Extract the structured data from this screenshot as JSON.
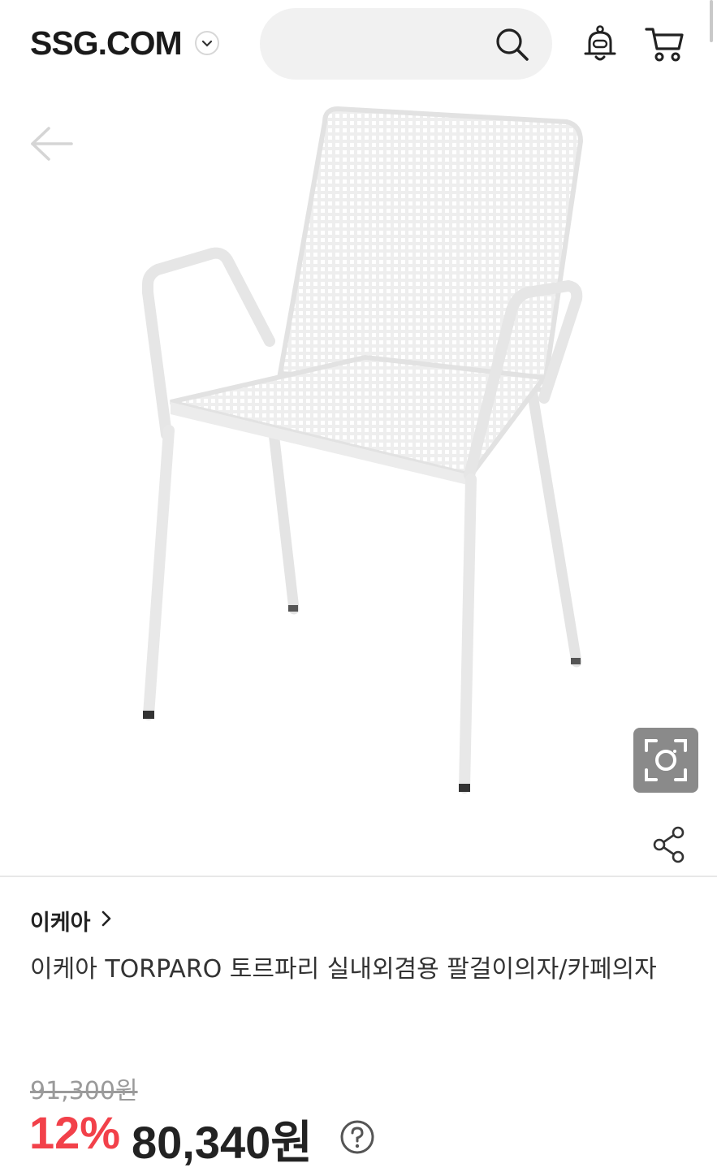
{
  "header": {
    "logo": "SSG.COM",
    "search_placeholder": ""
  },
  "icons": {
    "logo_dropdown": "chevron-down-icon",
    "search": "search-icon",
    "notification": "bell-icon",
    "cart": "cart-icon",
    "back": "back-arrow-icon",
    "lens": "lens-search-icon",
    "share": "share-icon",
    "brand_link": "chevron-right-icon",
    "help": "help-icon"
  },
  "product": {
    "brand": "이케아",
    "title": "이케아 TORPARO 토르파리 실내외겸용 팔걸이의자/카페의자",
    "original_price": "91,300원",
    "discount": "12%",
    "sale_price": "80,340원"
  },
  "colors": {
    "discount": "#f2414a",
    "lens_button": "#8a8a8a"
  }
}
